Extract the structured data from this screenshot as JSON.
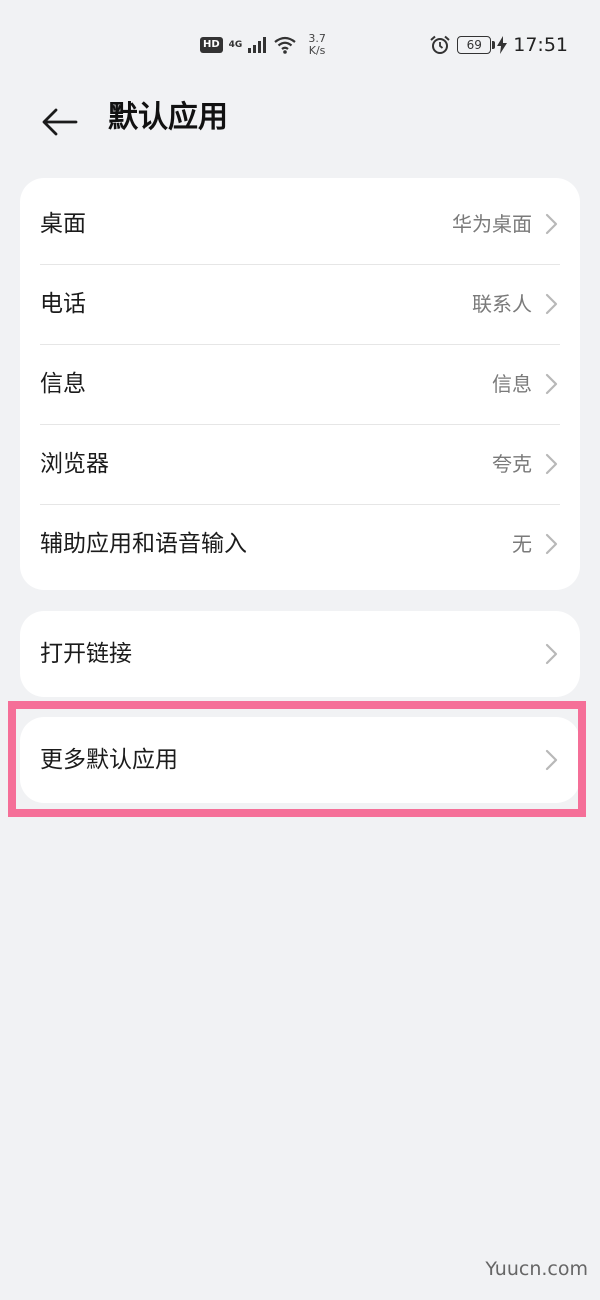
{
  "status_bar": {
    "hd": "HD",
    "network": "4G",
    "speed_value": "3.7",
    "speed_unit": "K/s",
    "battery": "69",
    "time": "17:51"
  },
  "header": {
    "title": "默认应用"
  },
  "default_apps": [
    {
      "label": "桌面",
      "value": "华为桌面"
    },
    {
      "label": "电话",
      "value": "联系人"
    },
    {
      "label": "信息",
      "value": "信息"
    },
    {
      "label": "浏览器",
      "value": "夸克"
    },
    {
      "label": "辅助应用和语音输入",
      "value": "无"
    }
  ],
  "open_links": {
    "label": "打开链接"
  },
  "more_defaults": {
    "label": "更多默认应用"
  },
  "watermark": "Yuucn.com",
  "colors": {
    "background": "#f1f2f4",
    "card": "#ffffff",
    "highlight": "#f56f98"
  }
}
